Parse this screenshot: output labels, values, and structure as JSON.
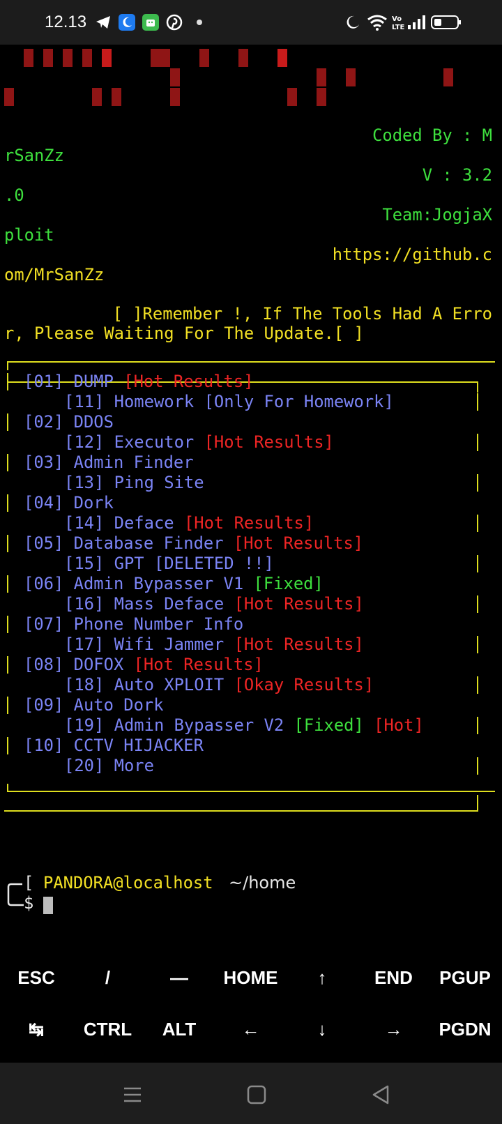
{
  "status_bar": {
    "time": "12.13",
    "icons": [
      "telegram-icon",
      "moon-app-icon",
      "android-app-icon",
      "pinterest-icon",
      "notification-dot-icon",
      "do-not-disturb-icon",
      "wifi-icon",
      "volte-icon",
      "signal-icon",
      "battery-icon"
    ]
  },
  "colors": {
    "green": "#3ee03e",
    "yellow": "#f2e024",
    "blue": "#7b84f5",
    "red": "#ee2525",
    "box": "#dede1e"
  },
  "credits": {
    "coded_by_1": "Coded By : M",
    "coded_by_2": "rSanZz",
    "version_1": "V : 3.2",
    "version_2": ".0",
    "team_1": "Team:JogjaX",
    "team_2": "ploit",
    "url_1": "https://github.c",
    "url_2": "om/MrSanZz"
  },
  "notice": {
    "line1": "[ ]Remember !, If The Tools Had A Erro",
    "line2": "r, Please Waiting For The Update.[ ]"
  },
  "menu": [
    {
      "num": "[01]",
      "name": "DUMP",
      "tag": "[Hot Results]",
      "tag_color": "red"
    },
    {
      "num": "[11]",
      "name": "Homework",
      "tag": "[Only For Homework]",
      "tag_color": "blue"
    },
    {
      "num": "[02]",
      "name": "DDOS",
      "tag": "",
      "tag_color": ""
    },
    {
      "num": "[12]",
      "name": "Executor",
      "tag": "[Hot Results]",
      "tag_color": "red"
    },
    {
      "num": "[03]",
      "name": "Admin Finder",
      "tag": "",
      "tag_color": ""
    },
    {
      "num": "[13]",
      "name": "Ping Site",
      "tag": "",
      "tag_color": ""
    },
    {
      "num": "[04]",
      "name": "Dork",
      "tag": "",
      "tag_color": ""
    },
    {
      "num": "[14]",
      "name": "Deface",
      "tag": "[Hot Results]",
      "tag_color": "red"
    },
    {
      "num": "[05]",
      "name": "Database Finder",
      "tag": "[Hot Results]",
      "tag_color": "red"
    },
    {
      "num": "[15]",
      "name": "GPT",
      "tag": "[DELETED !!]",
      "tag_color": "blue"
    },
    {
      "num": "[06]",
      "name": "Admin Bypasser V1",
      "tag": "[Fixed]",
      "tag_color": "green"
    },
    {
      "num": "[16]",
      "name": "Mass Deface",
      "tag": "[Hot Results]",
      "tag_color": "red"
    },
    {
      "num": "[07]",
      "name": "Phone Number Info",
      "tag": "",
      "tag_color": ""
    },
    {
      "num": "[17]",
      "name": "Wifi Jammer",
      "tag": "[Hot Results]",
      "tag_color": "red"
    },
    {
      "num": "[08]",
      "name": "DOFOX",
      "tag": "[Hot Results]",
      "tag_color": "red"
    },
    {
      "num": "[18]",
      "name": "Auto XPLOIT",
      "tag": "[Okay Results]",
      "tag_color": "red"
    },
    {
      "num": "[09]",
      "name": "Auto Dork",
      "tag": "",
      "tag_color": ""
    },
    {
      "num": "[19]",
      "name": "Admin Bypasser V2",
      "tag": "[Fixed]",
      "tag_color": "green",
      "tag2": "[Hot]",
      "tag2_color": "red"
    },
    {
      "num": "[10]",
      "name": "CCTV HIJACKER",
      "tag": "",
      "tag_color": ""
    },
    {
      "num": "[20]",
      "name": "More",
      "tag": "",
      "tag_color": ""
    }
  ],
  "prompt": {
    "open_bracket": "[",
    "user_host": "PANDORA@localhost",
    "path": "~/home",
    "symbol": "$"
  },
  "extra_keys": {
    "row1": [
      "ESC",
      "/",
      "—",
      "HOME",
      "↑",
      "END",
      "PGUP"
    ],
    "row2": [
      "↹",
      "CTRL",
      "ALT",
      "←",
      "↓",
      "→",
      "PGDN"
    ]
  },
  "nav_bar": {
    "icons": [
      "menu-icon",
      "home-icon",
      "back-icon"
    ]
  }
}
